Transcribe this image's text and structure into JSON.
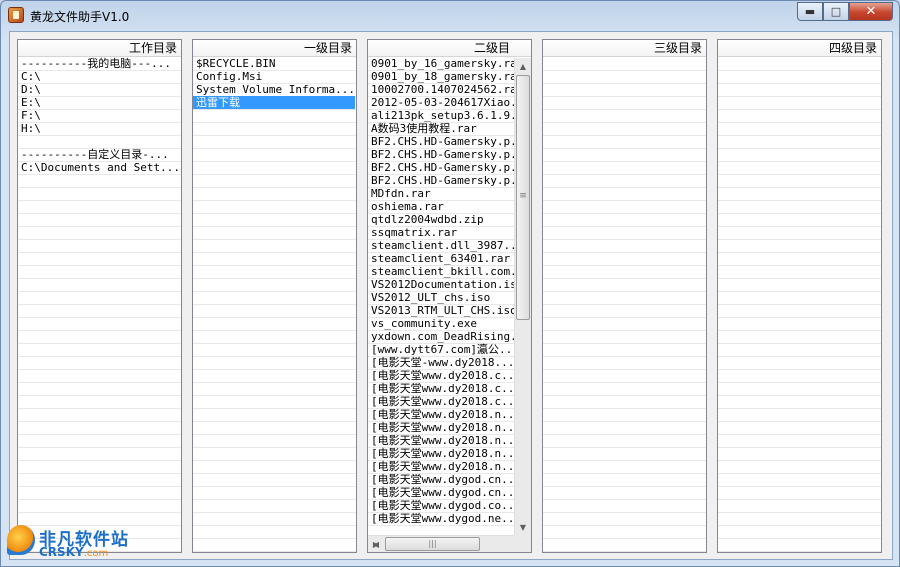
{
  "window": {
    "title": "黄龙文件助手V1.0",
    "controls": {
      "minimize": "▬",
      "maximize": "□",
      "close": "✕"
    }
  },
  "panels": {
    "work": {
      "header": "工作目录",
      "items": [
        "----------我的电脑---...",
        "C:\\",
        "D:\\",
        "E:\\",
        "F:\\",
        "H:\\",
        "",
        "----------自定义目录-...",
        "C:\\Documents and Sett..."
      ]
    },
    "level1": {
      "header": "一级目录",
      "items": [
        "$RECYCLE.BIN",
        "Config.Msi",
        "System Volume Informa...",
        "迅雷下载"
      ],
      "selected_index": 3
    },
    "level2": {
      "header": "二级目",
      "items": [
        "0901_by_16_gamersky.ra",
        "0901_by_18_gamersky.ra",
        "10002700.1407024562.ra",
        "2012-05-03-204617Xiao.",
        "ali213pk_setup3.6.1.9.",
        "A数码3使用教程.rar",
        "BF2.CHS.HD-Gamersky.p.",
        "BF2.CHS.HD-Gamersky.p.",
        "BF2.CHS.HD-Gamersky.p.",
        "BF2.CHS.HD-Gamersky.p.",
        "MDfdn.rar",
        "oshiema.rar",
        "qtdlz2004wdbd.zip",
        "ssqmatrix.rar",
        "steamclient.dll_3987..",
        "steamclient_63401.rar",
        "steamclient_bkill.com.",
        "VS2012Documentation.is",
        "VS2012_ULT_chs.iso",
        "VS2013_RTM_ULT_CHS.iso",
        "vs_community.exe",
        "yxdown.com_DeadRising.",
        "[www.dytt67.com]瀛公...",
        "[电影天堂-www.dy2018....",
        "[电影天堂www.dy2018.c..",
        "[电影天堂www.dy2018.c..",
        "[电影天堂www.dy2018.c..",
        "[电影天堂www.dy2018.n..",
        "[电影天堂www.dy2018.n..",
        "[电影天堂www.dy2018.n..",
        "[电影天堂www.dy2018.n..",
        "[电影天堂www.dy2018.n..",
        "[电影天堂www.dygod.cn..",
        "[电影天堂www.dygod.cn..",
        "[电影天堂www.dygod.co..",
        "[电影天堂www.dygod.ne.."
      ],
      "scroll": {
        "up": "▲",
        "down": "▼",
        "left": "◀",
        "right": "▶",
        "grip": "≡",
        "hgrip": "|||"
      }
    },
    "level3": {
      "header": "三级目录",
      "items": []
    },
    "level4": {
      "header": "四级目录",
      "items": []
    }
  },
  "watermark": {
    "cn": "非凡软件站",
    "en": "CRSKY",
    "domain": ".com"
  }
}
